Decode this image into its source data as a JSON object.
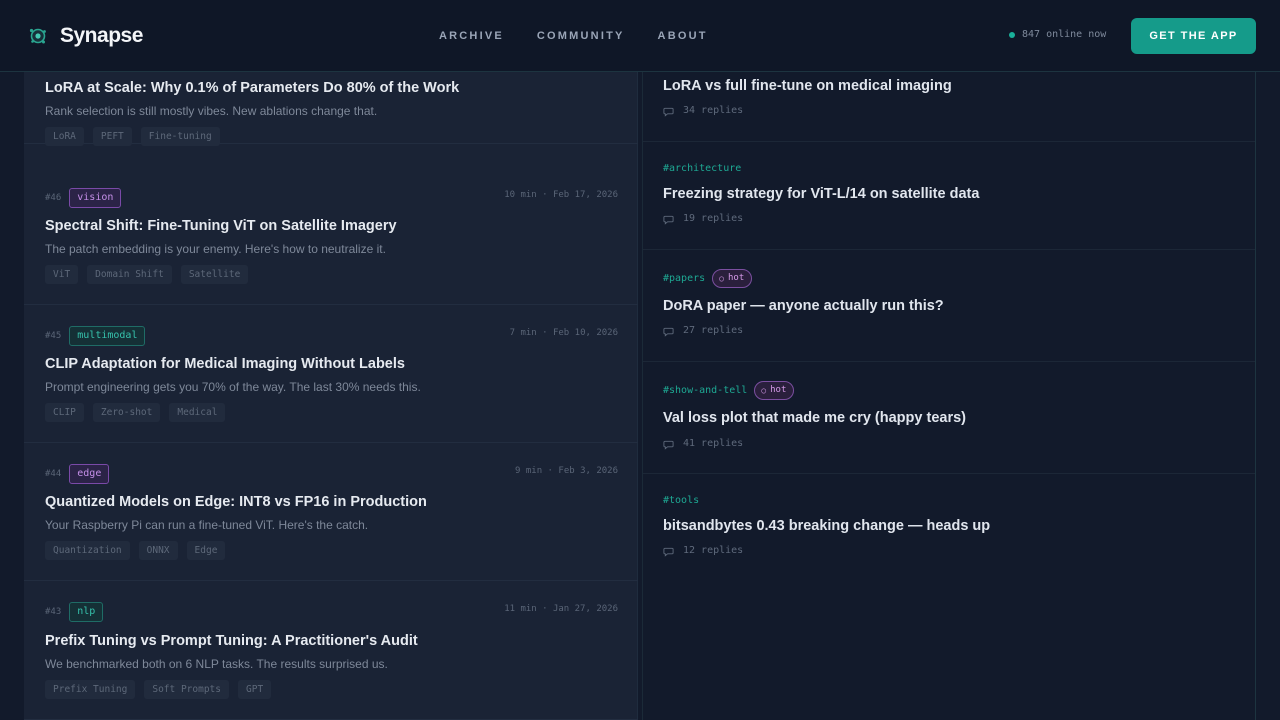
{
  "nav": {
    "logo_text": "Synapse",
    "links": [
      "ARCHIVE",
      "COMMUNITY",
      "ABOUT"
    ],
    "online_text": "847 online now",
    "cta_label": "GET THE APP"
  },
  "colors": {
    "accent_teal": "#159b8a",
    "purple_badge": "#c58fe8",
    "teal_badge": "#36c2ac",
    "background": "#121a2b"
  },
  "articles": [
    {
      "num": "",
      "category": "",
      "meta": "",
      "title": "LoRA at Scale: Why 0.1% of Parameters Do 80% of the Work",
      "description": "Rank selection is still mostly vibes. New ablations change that.",
      "tags": [
        "LoRA",
        "PEFT",
        "Fine-tuning"
      ]
    },
    {
      "num": "#46",
      "category": "vision",
      "meta": "10 min · Feb 17, 2026",
      "title": "Spectral Shift: Fine-Tuning ViT on Satellite Imagery",
      "description": "The patch embedding is your enemy. Here's how to neutralize it.",
      "tags": [
        "ViT",
        "Domain Shift",
        "Satellite"
      ]
    },
    {
      "num": "#45",
      "category": "multimodal",
      "meta": "7 min · Feb 10, 2026",
      "title": "CLIP Adaptation for Medical Imaging Without Labels",
      "description": "Prompt engineering gets you 70% of the way. The last 30% needs this.",
      "tags": [
        "CLIP",
        "Zero-shot",
        "Medical"
      ]
    },
    {
      "num": "#44",
      "category": "edge",
      "meta": "9 min · Feb 3, 2026",
      "title": "Quantized Models on Edge: INT8 vs FP16 in Production",
      "description": "Your Raspberry Pi can run a fine-tuned ViT. Here's the catch.",
      "tags": [
        "Quantization",
        "ONNX",
        "Edge"
      ]
    },
    {
      "num": "#43",
      "category": "nlp",
      "meta": "11 min · Jan 27, 2026",
      "title": "Prefix Tuning vs Prompt Tuning: A Practitioner's Audit",
      "description": "We benchmarked both on 6 NLP tasks. The results surprised us.",
      "tags": [
        "Prefix Tuning",
        "Soft Prompts",
        "GPT"
      ]
    }
  ],
  "threads": [
    {
      "channel": "",
      "hot": "",
      "title": "LoRA vs full fine-tune on medical imaging",
      "replies": "34 replies"
    },
    {
      "channel": "#architecture",
      "hot": "",
      "title": "Freezing strategy for ViT-L/14 on satellite data",
      "replies": "19 replies"
    },
    {
      "channel": "#papers",
      "hot": "hot",
      "title": "DoRA paper — anyone actually run this?",
      "replies": "27 replies"
    },
    {
      "channel": "#show-and-tell",
      "hot": "hot",
      "title": "Val loss plot that made me cry (happy tears)",
      "replies": "41 replies"
    },
    {
      "channel": "#tools",
      "hot": "",
      "title": "bitsandbytes 0.43 breaking change — heads up",
      "replies": "12 replies"
    }
  ]
}
